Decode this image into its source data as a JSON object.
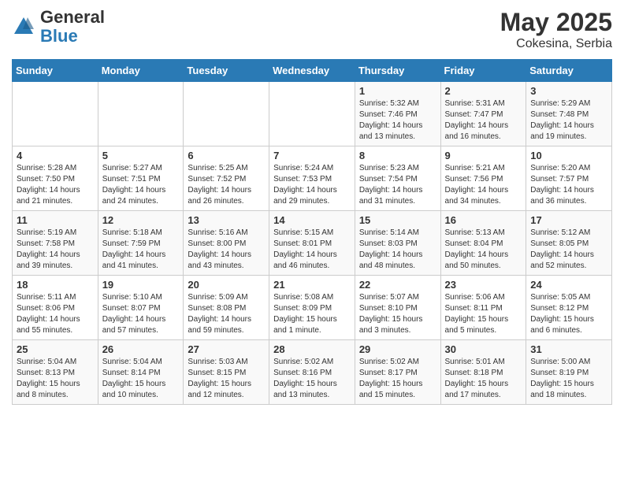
{
  "header": {
    "logo_general": "General",
    "logo_blue": "Blue",
    "title": "May 2025",
    "location": "Cokesina, Serbia"
  },
  "weekdays": [
    "Sunday",
    "Monday",
    "Tuesday",
    "Wednesday",
    "Thursday",
    "Friday",
    "Saturday"
  ],
  "weeks": [
    [
      {
        "day": "",
        "info": ""
      },
      {
        "day": "",
        "info": ""
      },
      {
        "day": "",
        "info": ""
      },
      {
        "day": "",
        "info": ""
      },
      {
        "day": "1",
        "info": "Sunrise: 5:32 AM\nSunset: 7:46 PM\nDaylight: 14 hours\nand 13 minutes."
      },
      {
        "day": "2",
        "info": "Sunrise: 5:31 AM\nSunset: 7:47 PM\nDaylight: 14 hours\nand 16 minutes."
      },
      {
        "day": "3",
        "info": "Sunrise: 5:29 AM\nSunset: 7:48 PM\nDaylight: 14 hours\nand 19 minutes."
      }
    ],
    [
      {
        "day": "4",
        "info": "Sunrise: 5:28 AM\nSunset: 7:50 PM\nDaylight: 14 hours\nand 21 minutes."
      },
      {
        "day": "5",
        "info": "Sunrise: 5:27 AM\nSunset: 7:51 PM\nDaylight: 14 hours\nand 24 minutes."
      },
      {
        "day": "6",
        "info": "Sunrise: 5:25 AM\nSunset: 7:52 PM\nDaylight: 14 hours\nand 26 minutes."
      },
      {
        "day": "7",
        "info": "Sunrise: 5:24 AM\nSunset: 7:53 PM\nDaylight: 14 hours\nand 29 minutes."
      },
      {
        "day": "8",
        "info": "Sunrise: 5:23 AM\nSunset: 7:54 PM\nDaylight: 14 hours\nand 31 minutes."
      },
      {
        "day": "9",
        "info": "Sunrise: 5:21 AM\nSunset: 7:56 PM\nDaylight: 14 hours\nand 34 minutes."
      },
      {
        "day": "10",
        "info": "Sunrise: 5:20 AM\nSunset: 7:57 PM\nDaylight: 14 hours\nand 36 minutes."
      }
    ],
    [
      {
        "day": "11",
        "info": "Sunrise: 5:19 AM\nSunset: 7:58 PM\nDaylight: 14 hours\nand 39 minutes."
      },
      {
        "day": "12",
        "info": "Sunrise: 5:18 AM\nSunset: 7:59 PM\nDaylight: 14 hours\nand 41 minutes."
      },
      {
        "day": "13",
        "info": "Sunrise: 5:16 AM\nSunset: 8:00 PM\nDaylight: 14 hours\nand 43 minutes."
      },
      {
        "day": "14",
        "info": "Sunrise: 5:15 AM\nSunset: 8:01 PM\nDaylight: 14 hours\nand 46 minutes."
      },
      {
        "day": "15",
        "info": "Sunrise: 5:14 AM\nSunset: 8:03 PM\nDaylight: 14 hours\nand 48 minutes."
      },
      {
        "day": "16",
        "info": "Sunrise: 5:13 AM\nSunset: 8:04 PM\nDaylight: 14 hours\nand 50 minutes."
      },
      {
        "day": "17",
        "info": "Sunrise: 5:12 AM\nSunset: 8:05 PM\nDaylight: 14 hours\nand 52 minutes."
      }
    ],
    [
      {
        "day": "18",
        "info": "Sunrise: 5:11 AM\nSunset: 8:06 PM\nDaylight: 14 hours\nand 55 minutes."
      },
      {
        "day": "19",
        "info": "Sunrise: 5:10 AM\nSunset: 8:07 PM\nDaylight: 14 hours\nand 57 minutes."
      },
      {
        "day": "20",
        "info": "Sunrise: 5:09 AM\nSunset: 8:08 PM\nDaylight: 14 hours\nand 59 minutes."
      },
      {
        "day": "21",
        "info": "Sunrise: 5:08 AM\nSunset: 8:09 PM\nDaylight: 15 hours\nand 1 minute."
      },
      {
        "day": "22",
        "info": "Sunrise: 5:07 AM\nSunset: 8:10 PM\nDaylight: 15 hours\nand 3 minutes."
      },
      {
        "day": "23",
        "info": "Sunrise: 5:06 AM\nSunset: 8:11 PM\nDaylight: 15 hours\nand 5 minutes."
      },
      {
        "day": "24",
        "info": "Sunrise: 5:05 AM\nSunset: 8:12 PM\nDaylight: 15 hours\nand 6 minutes."
      }
    ],
    [
      {
        "day": "25",
        "info": "Sunrise: 5:04 AM\nSunset: 8:13 PM\nDaylight: 15 hours\nand 8 minutes."
      },
      {
        "day": "26",
        "info": "Sunrise: 5:04 AM\nSunset: 8:14 PM\nDaylight: 15 hours\nand 10 minutes."
      },
      {
        "day": "27",
        "info": "Sunrise: 5:03 AM\nSunset: 8:15 PM\nDaylight: 15 hours\nand 12 minutes."
      },
      {
        "day": "28",
        "info": "Sunrise: 5:02 AM\nSunset: 8:16 PM\nDaylight: 15 hours\nand 13 minutes."
      },
      {
        "day": "29",
        "info": "Sunrise: 5:02 AM\nSunset: 8:17 PM\nDaylight: 15 hours\nand 15 minutes."
      },
      {
        "day": "30",
        "info": "Sunrise: 5:01 AM\nSunset: 8:18 PM\nDaylight: 15 hours\nand 17 minutes."
      },
      {
        "day": "31",
        "info": "Sunrise: 5:00 AM\nSunset: 8:19 PM\nDaylight: 15 hours\nand 18 minutes."
      }
    ]
  ]
}
